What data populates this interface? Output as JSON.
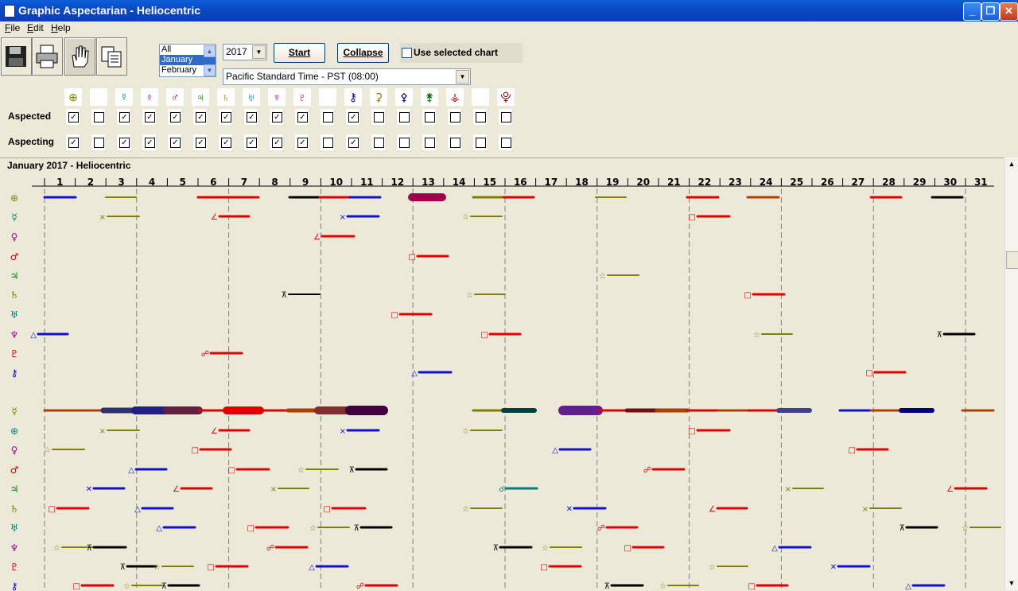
{
  "window": {
    "title": "Graphic Aspectarian - Heliocentric"
  },
  "menu": [
    "File",
    "Edit",
    "Help"
  ],
  "toolbar": {
    "buttons": [
      "save-icon",
      "print-icon",
      "hand-icon",
      "copy-icon"
    ]
  },
  "month_list": {
    "items": [
      "All",
      "January",
      "February"
    ],
    "selected": "January"
  },
  "year_select": {
    "value": "2017"
  },
  "start_button": "Start",
  "collapse_button": "Collapse",
  "use_selected_chart": {
    "label": "Use selected chart",
    "checked": false
  },
  "timezone_select": {
    "value": "Pacific Standard Time - PST (08:00)"
  },
  "planet_symbols": [
    "⊕",
    "",
    "☿",
    "♀",
    "♂",
    "♃",
    "♄",
    "♅",
    "♆",
    "♇",
    "",
    "⚷",
    "⚳",
    "⚴",
    "⚵",
    "⚶",
    "",
    "⯓"
  ],
  "planet_colors": [
    "#808000",
    "#000",
    "#008080",
    "#A000A0",
    "#C00000",
    "#008000",
    "#808000",
    "#008080",
    "#A000A0",
    "#C00000",
    "#000",
    "#0000C0",
    "#A07000",
    "#000080",
    "#006000",
    "#C00000",
    "#000",
    "#800000"
  ],
  "aspected": {
    "label": "Aspected",
    "checked": [
      true,
      false,
      true,
      true,
      true,
      true,
      true,
      true,
      true,
      true,
      false,
      true,
      false,
      false,
      false,
      false,
      false,
      false
    ]
  },
  "aspecting": {
    "label": "Aspecting",
    "checked": [
      true,
      false,
      true,
      true,
      true,
      true,
      true,
      true,
      true,
      true,
      false,
      true,
      false,
      false,
      false,
      false,
      false,
      false
    ]
  },
  "chart": {
    "title": "January 2017 - Heliocentric",
    "days": [
      "1",
      "2",
      "3",
      "4",
      "5",
      "6",
      "7",
      "8",
      "9",
      "10",
      "11",
      "12",
      "13",
      "14",
      "15",
      "16",
      "17",
      "18",
      "19",
      "20",
      "21",
      "22",
      "23",
      "24",
      "25",
      "26",
      "27",
      "28",
      "29",
      "30",
      "31"
    ],
    "top_rows": [
      "⊕",
      "☿",
      "♀",
      "♂",
      "♃",
      "♄",
      "♅",
      "♆",
      "♇",
      "⚷"
    ],
    "bottom_rows": [
      "☿",
      "⊕",
      "♀",
      "♂",
      "♃",
      "♄",
      "♅",
      "♆",
      "♇",
      "⚷"
    ],
    "row_colors": [
      "#808000",
      "#008080",
      "#A000A0",
      "#C00000",
      "#008000",
      "#808000",
      "#008080",
      "#A000A0",
      "#C00000",
      "#0000C0"
    ]
  }
}
